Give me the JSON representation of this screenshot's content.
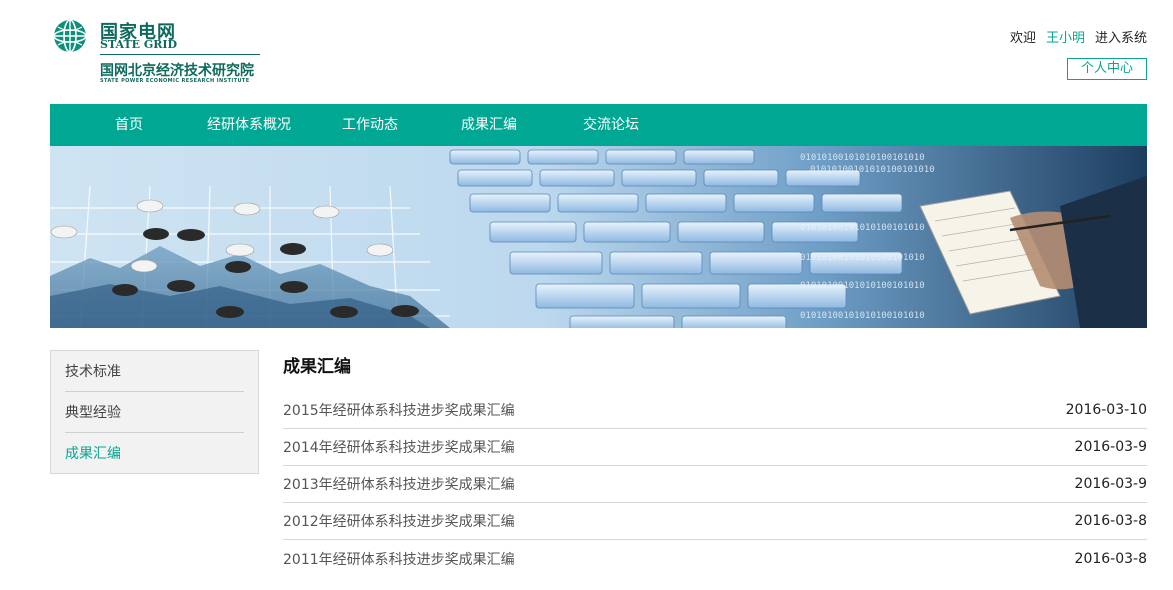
{
  "brand": {
    "name_cn": "国家电网",
    "name_en": "STATE GRID",
    "institute_cn": "国网北京经济技术研究院",
    "institute_en": "STATE POWER ECONOMIC RESEARCH INSTITUTE",
    "color": "#0e6a5c"
  },
  "user_bar": {
    "welcome": "欢迎",
    "username": "王小明",
    "enter_system": "进入系统",
    "personal_center": "个人中心"
  },
  "nav": {
    "items": [
      "首页",
      "经研体系概况",
      "工作动态",
      "成果汇编",
      "交流论坛"
    ],
    "color": "#00a894"
  },
  "sidebar": {
    "items": [
      {
        "label": "技术标准",
        "active": false
      },
      {
        "label": "典型经验",
        "active": false
      },
      {
        "label": "成果汇编",
        "active": true
      }
    ]
  },
  "content": {
    "title": "成果汇编",
    "rows": [
      {
        "title": "2015年经研体系科技进步奖成果汇编",
        "date": "2016-03-10"
      },
      {
        "title": "2014年经研体系科技进步奖成果汇编",
        "date": "2016-03-9"
      },
      {
        "title": "2013年经研体系科技进步奖成果汇编",
        "date": "2016-03-9"
      },
      {
        "title": "2012年经研体系科技进步奖成果汇编",
        "date": "2016-03-8"
      },
      {
        "title": "2011年经研体系科技进步奖成果汇编",
        "date": "2016-03-8"
      }
    ]
  },
  "banner": {
    "binary_text": "01010100101010100101010"
  }
}
